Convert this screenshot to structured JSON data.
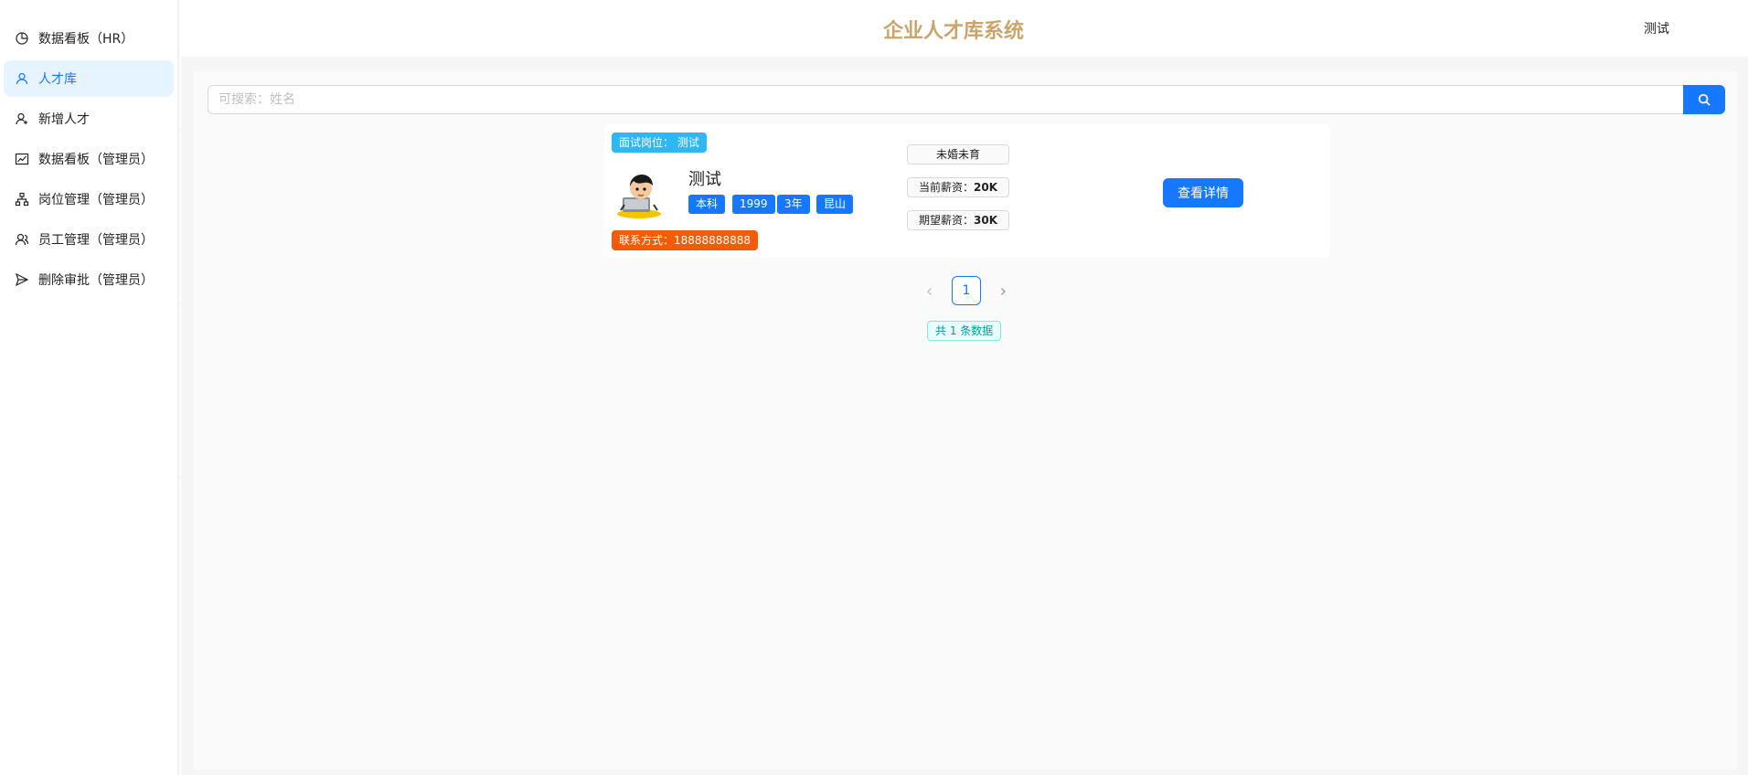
{
  "header": {
    "title": "企业人才库系统",
    "user": "测试"
  },
  "sidebar": {
    "items": [
      {
        "label": "数据看板（HR）",
        "icon": "pie-chart-icon",
        "active": false
      },
      {
        "label": "人才库",
        "icon": "user-icon",
        "active": true
      },
      {
        "label": "新增人才",
        "icon": "user-add-icon",
        "active": false
      },
      {
        "label": "数据看板（管理员）",
        "icon": "line-chart-icon",
        "active": false
      },
      {
        "label": "岗位管理（管理员）",
        "icon": "org-chart-icon",
        "active": false
      },
      {
        "label": "员工管理（管理员）",
        "icon": "team-icon",
        "active": false
      },
      {
        "label": "删除审批（管理员）",
        "icon": "send-icon",
        "active": false
      }
    ]
  },
  "search": {
    "placeholder": "可搜索：姓名",
    "value": ""
  },
  "candidate": {
    "position_tag": "面试岗位：  测试",
    "name": "测试",
    "education": "本科",
    "birth_year": "1999",
    "experience": "3年",
    "city": "昆山",
    "contact": "联系方式：18888888888",
    "marital": "未婚未育",
    "current_salary_label": "当前薪资：",
    "current_salary": "20K",
    "expected_salary_label": "期望薪资：",
    "expected_salary": "30K",
    "detail_button": "查看详情"
  },
  "pagination": {
    "current_page": "1",
    "total_text": "共 1 条数据"
  },
  "watermark": "测试",
  "colors": {
    "primary": "#1677ff",
    "title": "#c9a56b",
    "contact_tag": "#f25c05",
    "position_tag": "#2db7f5"
  }
}
